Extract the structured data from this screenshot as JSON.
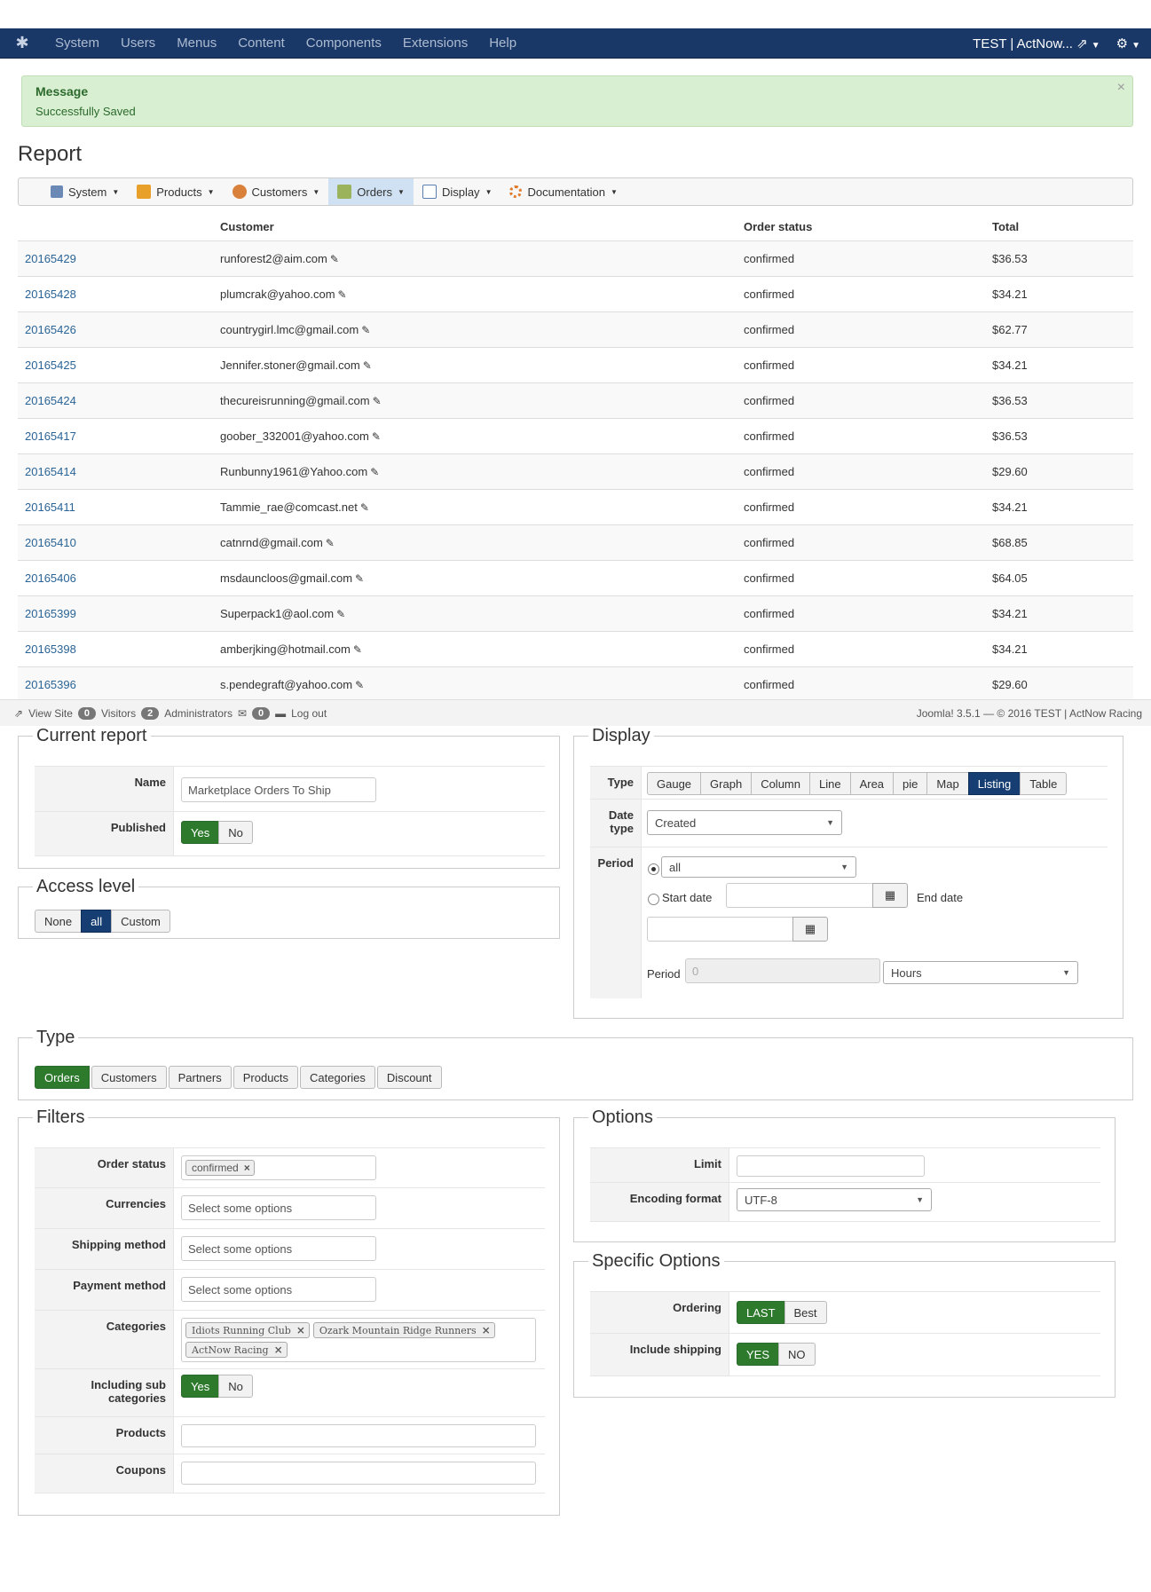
{
  "nav": {
    "logo_icon": "joomla-icon",
    "menu": [
      "System",
      "Users",
      "Menus",
      "Content",
      "Components",
      "Extensions",
      "Help"
    ],
    "site_name": "TEST | ActNow...",
    "gear_icon": "gear-icon"
  },
  "alert": {
    "heading": "Message",
    "text": "Successfully Saved",
    "close": "×"
  },
  "page_title": "Report",
  "subnav": {
    "items": [
      {
        "label": "System",
        "icon": "wrench-icon"
      },
      {
        "label": "Products",
        "icon": "box-icon"
      },
      {
        "label": "Customers",
        "icon": "users-icon"
      },
      {
        "label": "Orders",
        "icon": "orders-icon"
      },
      {
        "label": "Display",
        "icon": "display-icon"
      },
      {
        "label": "Documentation",
        "icon": "lifebuoy-icon"
      }
    ]
  },
  "table": {
    "headers": [
      "",
      "Customer",
      "Order status",
      "Total"
    ],
    "rows": [
      [
        "20165429",
        "runforest2@aim.com",
        "confirmed",
        "$36.53"
      ],
      [
        "20165428",
        "plumcrak@yahoo.com",
        "confirmed",
        "$34.21"
      ],
      [
        "20165426",
        "countrygirl.lmc@gmail.com",
        "confirmed",
        "$62.77"
      ],
      [
        "20165425",
        "Jennifer.stoner@gmail.com",
        "confirmed",
        "$34.21"
      ],
      [
        "20165424",
        "thecureisrunning@gmail.com",
        "confirmed",
        "$36.53"
      ],
      [
        "20165417",
        "goober_332001@yahoo.com",
        "confirmed",
        "$36.53"
      ],
      [
        "20165414",
        "Runbunny1961@Yahoo.com",
        "confirmed",
        "$29.60"
      ],
      [
        "20165411",
        "Tammie_rae@comcast.net",
        "confirmed",
        "$34.21"
      ],
      [
        "20165410",
        "catnrnd@gmail.com",
        "confirmed",
        "$68.85"
      ],
      [
        "20165406",
        "msdauncloos@gmail.com",
        "confirmed",
        "$64.05"
      ],
      [
        "20165399",
        "Superpack1@aol.com",
        "confirmed",
        "$34.21"
      ],
      [
        "20165398",
        "amberjking@hotmail.com",
        "confirmed",
        "$34.21"
      ],
      [
        "20165396",
        "s.pendegraft@yahoo.com",
        "confirmed",
        "$29.60"
      ]
    ]
  },
  "statusbar": {
    "view_site": "View Site",
    "visitors_count": "0",
    "visitors_label": "Visitors",
    "admins_count": "2",
    "admins_label": "Administrators",
    "messages_count": "0",
    "logout": "Log out",
    "version": "Joomla! 3.5.1  —  © 2016 TEST | ActNow Racing"
  },
  "current_report": {
    "legend": "Current report",
    "name_label": "Name",
    "name_value": "Marketplace Orders To Ship",
    "published_label": "Published",
    "published_options": [
      "Yes",
      "No"
    ],
    "published_selected": "Yes"
  },
  "access_level": {
    "legend": "Access level",
    "options": [
      "None",
      "all",
      "Custom"
    ],
    "selected": "all"
  },
  "display": {
    "legend": "Display",
    "type_label": "Type",
    "type_options": [
      "Gauge",
      "Graph",
      "Column",
      "Line",
      "Area",
      "pie",
      "Map",
      "Listing",
      "Table"
    ],
    "type_selected": "Listing",
    "date_type_label": "Date type",
    "date_type_value": "Created",
    "period_label": "Period",
    "period_value": "all",
    "start_date_label": "Start date",
    "end_date_label": "End date",
    "period_num_label": "Period",
    "period_num_placeholder": "0",
    "period_unit": "Hours"
  },
  "type_section": {
    "legend": "Type",
    "options": [
      "Orders",
      "Customers",
      "Partners",
      "Products",
      "Categories",
      "Discount"
    ],
    "selected": "Orders"
  },
  "filters": {
    "legend": "Filters",
    "order_status_label": "Order status",
    "order_status_tags": [
      "confirmed"
    ],
    "currencies_label": "Currencies",
    "shipping_label": "Shipping method",
    "payment_label": "Payment method",
    "placeholder": "Select some options",
    "categories_label": "Categories",
    "categories_tags": [
      "Idiots Running Club",
      "Ozark Mountain Ridge Runners",
      "ActNow Racing"
    ],
    "subcat_label": "Including sub categories",
    "subcat_options": [
      "Yes",
      "No"
    ],
    "subcat_selected": "Yes",
    "products_label": "Products",
    "coupons_label": "Coupons"
  },
  "options": {
    "legend": "Options",
    "limit_label": "Limit",
    "limit_value": "",
    "encoding_label": "Encoding format",
    "encoding_value": "UTF-8"
  },
  "specific": {
    "legend": "Specific Options",
    "ordering_label": "Ordering",
    "ordering_options": [
      "LAST",
      "Best"
    ],
    "ordering_selected": "LAST",
    "shipping_label": "Include shipping",
    "shipping_options": [
      "YES",
      "NO"
    ],
    "shipping_selected": "YES"
  },
  "colors": {
    "nav_bg": "#1a3867",
    "success_bg": "#d8efd2",
    "green": "#2d7a2d",
    "blue": "#163e72",
    "link": "#2a6496"
  }
}
